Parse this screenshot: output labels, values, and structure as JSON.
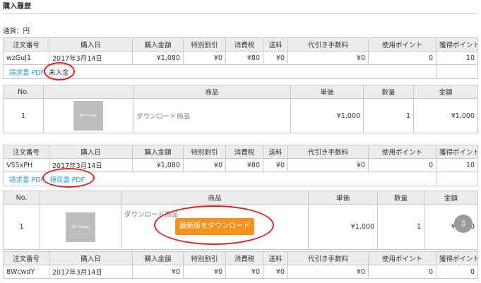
{
  "page": {
    "heading": "購入履歴",
    "currency": "通貨：円"
  },
  "order_headers": [
    "注文番号",
    "購入日",
    "購入金額",
    "特別割引",
    "消費税",
    "送料",
    "代引き手数料",
    "使用ポイント",
    "獲得ポイント"
  ],
  "item_headers": [
    "No.",
    "",
    "商品",
    "単価",
    "数量",
    "金額"
  ],
  "orders": [
    {
      "cells": [
        "wzGuJ1",
        "2017年3月14日",
        "¥1,080",
        "¥0",
        "¥80",
        "¥0",
        "¥0",
        "0",
        "10"
      ],
      "invoice_link": "請求書 PDF",
      "status": "未入金",
      "item": {
        "no": "1",
        "image_text": "No Image",
        "name": "ダウンロード商品",
        "unit_price": "¥1,000",
        "qty": "1",
        "amount": "¥1,000"
      }
    },
    {
      "cells": [
        "V55xPH",
        "2017年3月14日",
        "¥1,080",
        "¥0",
        "¥80",
        "¥0",
        "¥0",
        "0",
        "10"
      ],
      "invoice_link": "請求書 PDF",
      "receipt_link": "領収書 PDF",
      "item": {
        "no": "1",
        "image_text": "No Image",
        "name": "ダウンロード商品",
        "unit_price": "¥1,000",
        "qty": "1",
        "amount": "¥1,000",
        "download_button": "最新版をダウンロード"
      }
    },
    {
      "cells": [
        "8WcwdY",
        "2017年3月14日",
        "¥0",
        "¥0",
        "¥0",
        "¥0",
        "¥0",
        "0",
        "0"
      ]
    }
  ],
  "colors": {
    "link": "#2a9fd6",
    "button": "#f5921e",
    "annotation": "#dd2222",
    "header_bg": "#ececec"
  },
  "icons": [
    "download-circle-icon"
  ]
}
